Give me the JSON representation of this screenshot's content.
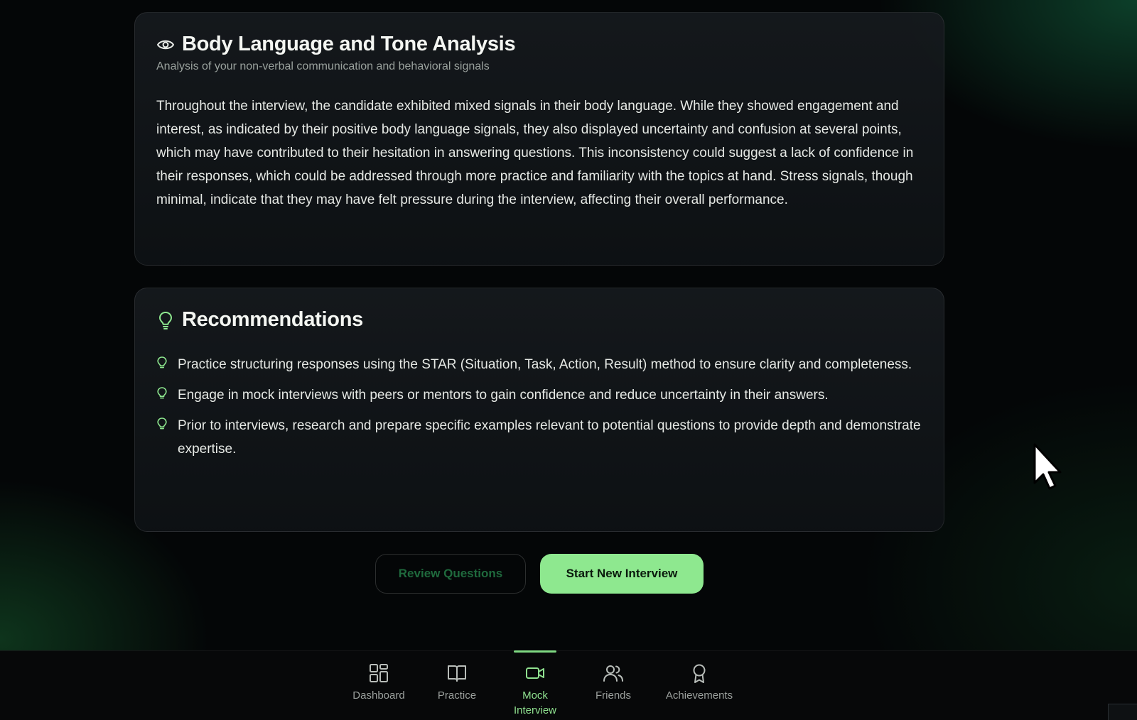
{
  "analysis": {
    "icon": "eye-icon",
    "title": "Body Language and Tone Analysis",
    "subtitle": "Analysis of your non-verbal communication and behavioral signals",
    "body": "Throughout the interview, the candidate exhibited mixed signals in their body language. While they showed engagement and interest, as indicated by their positive body language signals, they also displayed uncertainty and confusion at several points, which may have contributed to their hesitation in answering questions. This inconsistency could suggest a lack of confidence in their responses, which could be addressed through more practice and familiarity with the topics at hand. Stress signals, though minimal, indicate that they may have felt pressure during the interview, affecting their overall performance."
  },
  "recommendations": {
    "icon": "lightbulb-icon",
    "title": "Recommendations",
    "items": [
      "Practice structuring responses using the STAR (Situation, Task, Action, Result) method to ensure clarity and completeness.",
      "Engage in mock interviews with peers or mentors to gain confidence and reduce uncertainty in their answers.",
      "Prior to interviews, research and prepare specific examples relevant to potential questions to provide depth and demonstrate expertise."
    ]
  },
  "actions": {
    "review_label": "Review Questions",
    "start_label": "Start New Interview"
  },
  "bottom_nav": {
    "items": [
      {
        "label": "Dashboard",
        "icon": "dashboard-grid-icon",
        "active": false
      },
      {
        "label": "Practice",
        "icon": "book-icon",
        "active": false
      },
      {
        "label": "Mock Interview",
        "icon": "video-camera-icon",
        "active": true
      },
      {
        "label": "Friends",
        "icon": "friends-icon",
        "active": false
      },
      {
        "label": "Achievements",
        "icon": "award-icon",
        "active": false
      }
    ]
  },
  "colors": {
    "accent": "#8ee88f",
    "background": "#040607",
    "card": "#14181b"
  }
}
